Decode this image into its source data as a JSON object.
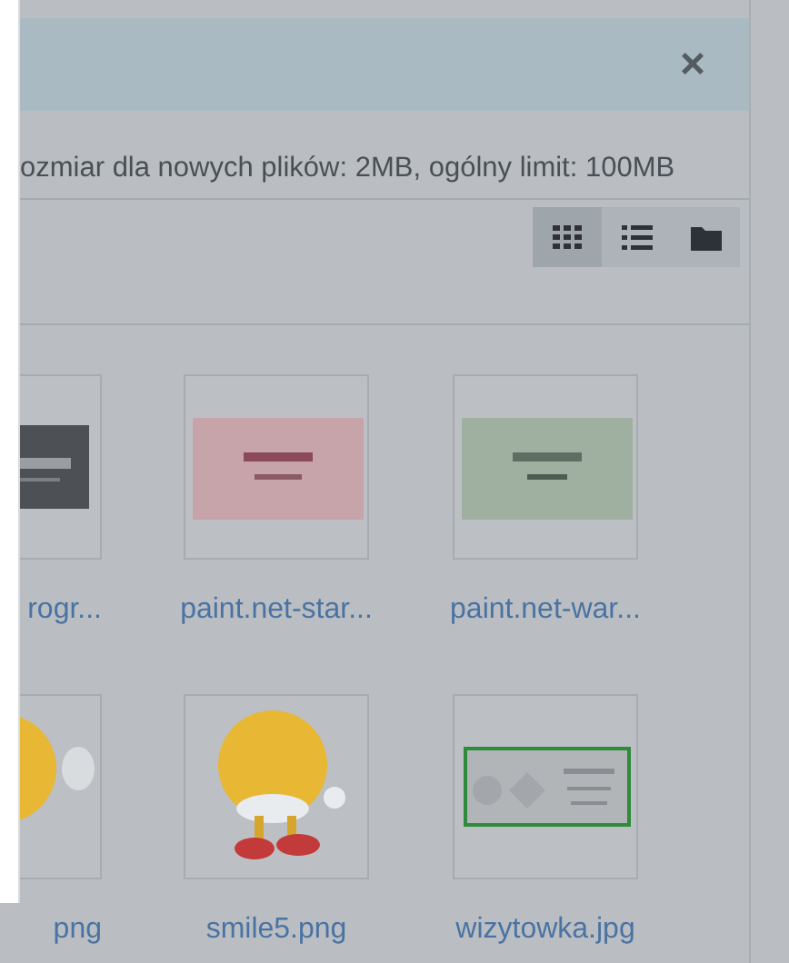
{
  "alert": {
    "close": "×"
  },
  "limits_text": "ozmiar dla nowych plików: 2MB, ogólny limit: 100MB",
  "view_buttons": [
    {
      "kind": "grid",
      "selected": true
    },
    {
      "kind": "list",
      "selected": false
    },
    {
      "kind": "tree",
      "selected": false
    }
  ],
  "files": [
    {
      "name": "rogr...",
      "kind": "picture"
    },
    {
      "name": "paint.net-star...",
      "kind": "picture"
    },
    {
      "name": "paint.net-war...",
      "kind": "picture"
    },
    {
      "name": "png",
      "kind": "picture"
    },
    {
      "name": "smile5.png",
      "kind": "picture"
    },
    {
      "name": "wizytowka.jpg",
      "kind": "picture"
    }
  ]
}
